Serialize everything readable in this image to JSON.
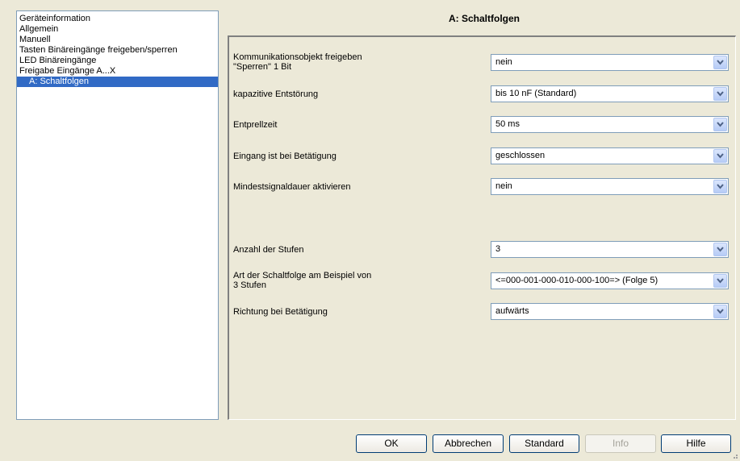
{
  "sidebar": {
    "items": [
      {
        "label": "Geräteinformation"
      },
      {
        "label": "Allgemein"
      },
      {
        "label": "Manuell"
      },
      {
        "label": "Tasten Binäreingänge freigeben/sperren"
      },
      {
        "label": "LED Binäreingänge"
      },
      {
        "label": "Freigabe Eingänge A...X"
      },
      {
        "label": "A: Schaltfolgen",
        "selected": true
      }
    ]
  },
  "page": {
    "title": "A: Schaltfolgen"
  },
  "params": [
    {
      "label_line1": "Kommunikationsobjekt freigeben",
      "label_line2": "\"Sperren\" 1 Bit",
      "value": "nein"
    },
    {
      "label_line1": "kapazitive Entstörung",
      "label_line2": "",
      "value": "bis 10 nF (Standard)"
    },
    {
      "label_line1": "Entprellzeit",
      "label_line2": "",
      "value": "50 ms"
    },
    {
      "label_line1": "Eingang ist bei Betätigung",
      "label_line2": "",
      "value": "geschlossen"
    },
    {
      "label_line1": "Mindestsignaldauer aktivieren",
      "label_line2": "",
      "value": "nein"
    },
    {
      "label_line1": "Anzahl der Stufen",
      "label_line2": "",
      "value": "3"
    },
    {
      "label_line1": "Art der Schaltfolge am Beispiel von",
      "label_line2": "3 Stufen",
      "value": "<=000-001-000-010-000-100=> (Folge 5)"
    },
    {
      "label_line1": "Richtung bei Betätigung",
      "label_line2": "",
      "value": "aufwärts"
    }
  ],
  "buttons": {
    "ok": "OK",
    "cancel": "Abbrechen",
    "standard": "Standard",
    "info": "Info",
    "help": "Hilfe"
  },
  "icons": {
    "dropdown": "chevron-down-icon",
    "grip": "resize-grip-icon"
  },
  "colors": {
    "selection": "#316ac5",
    "dialog_bg": "#ece9d8",
    "dropdown_arrow": "#4d6185"
  }
}
